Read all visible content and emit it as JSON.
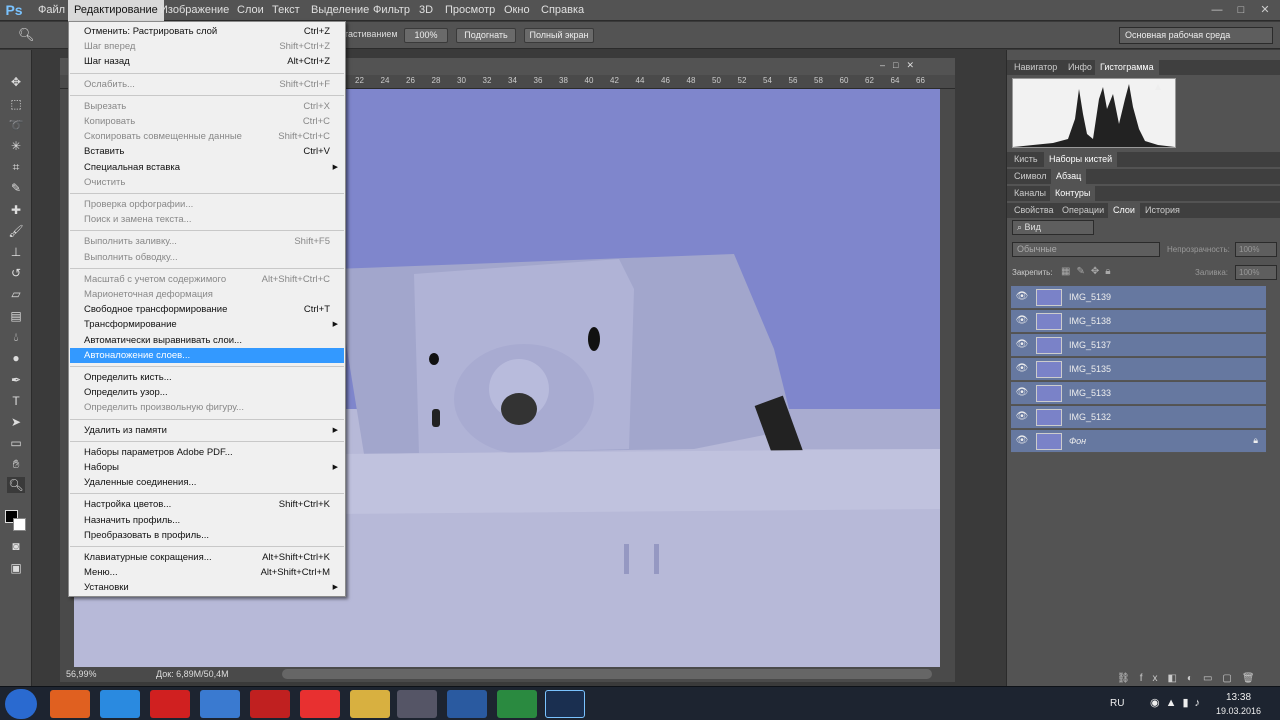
{
  "app": {
    "logo": "Ps"
  },
  "menubar": {
    "items": [
      "Файл",
      "Редактирование",
      "Изображение",
      "Слои",
      "Текст",
      "Выделение",
      "Фильтр",
      "3D",
      "Просмотр",
      "Окно",
      "Справка"
    ]
  },
  "window_controls": {
    "min": "—",
    "max": "□",
    "close": "✕"
  },
  "options_bar": {
    "scrub_label": "тастиванием",
    "btn_100": "100%",
    "btn_fit": "Подогнать",
    "btn_full": "Полный экран",
    "workspace": "Основная рабочая среда"
  },
  "ruler": {
    "ticks": [
      "22",
      "24",
      "26",
      "28",
      "30",
      "32",
      "34",
      "36",
      "38",
      "40",
      "42",
      "44",
      "46",
      "48",
      "50",
      "52",
      "54",
      "56",
      "58",
      "60",
      "62",
      "64",
      "66"
    ]
  },
  "status": {
    "zoom": "56,99%",
    "doc": "Док: 6,89M/50,4M"
  },
  "edit_menu": [
    {
      "label": "Отменить: Растрировать слой",
      "shortcut": "Ctrl+Z",
      "disabled": false
    },
    {
      "label": "Шаг вперед",
      "shortcut": "Shift+Ctrl+Z",
      "disabled": true
    },
    {
      "label": "Шаг назад",
      "shortcut": "Alt+Ctrl+Z",
      "disabled": false
    },
    {
      "sep": true
    },
    {
      "label": "Ослабить...",
      "shortcut": "Shift+Ctrl+F",
      "disabled": true
    },
    {
      "sep": true
    },
    {
      "label": "Вырезать",
      "shortcut": "Ctrl+X",
      "disabled": true
    },
    {
      "label": "Копировать",
      "shortcut": "Ctrl+C",
      "disabled": true
    },
    {
      "label": "Скопировать совмещенные данные",
      "shortcut": "Shift+Ctrl+C",
      "disabled": true
    },
    {
      "label": "Вставить",
      "shortcut": "Ctrl+V",
      "disabled": false
    },
    {
      "label": "Специальная вставка",
      "shortcut": "",
      "submenu": true,
      "disabled": false
    },
    {
      "label": "Очистить",
      "shortcut": "",
      "disabled": true
    },
    {
      "sep": true
    },
    {
      "label": "Проверка орфографии...",
      "shortcut": "",
      "disabled": true
    },
    {
      "label": "Поиск и замена текста...",
      "shortcut": "",
      "disabled": true
    },
    {
      "sep": true
    },
    {
      "label": "Выполнить заливку...",
      "shortcut": "Shift+F5",
      "disabled": true
    },
    {
      "label": "Выполнить обводку...",
      "shortcut": "",
      "disabled": true
    },
    {
      "sep": true
    },
    {
      "label": "Масштаб с учетом содержимого",
      "shortcut": "Alt+Shift+Ctrl+C",
      "disabled": true
    },
    {
      "label": "Марионеточная деформация",
      "shortcut": "",
      "disabled": true
    },
    {
      "label": "Свободное трансформирование",
      "shortcut": "Ctrl+T",
      "disabled": false
    },
    {
      "label": "Трансформирование",
      "shortcut": "",
      "submenu": true,
      "disabled": false
    },
    {
      "label": "Автоматически выравнивать слои...",
      "shortcut": "",
      "disabled": false
    },
    {
      "label": "Автоналожение слоев...",
      "shortcut": "",
      "disabled": false,
      "highlighted": true
    },
    {
      "sep": true
    },
    {
      "label": "Определить кисть...",
      "shortcut": "",
      "disabled": false
    },
    {
      "label": "Определить узор...",
      "shortcut": "",
      "disabled": false
    },
    {
      "label": "Определить произвольную фигуру...",
      "shortcut": "",
      "disabled": true
    },
    {
      "sep": true
    },
    {
      "label": "Удалить из памяти",
      "shortcut": "",
      "submenu": true,
      "disabled": false
    },
    {
      "sep": true
    },
    {
      "label": "Наборы параметров Adobe PDF...",
      "shortcut": "",
      "disabled": false
    },
    {
      "label": "Наборы",
      "shortcut": "",
      "submenu": true,
      "disabled": false
    },
    {
      "label": "Удаленные соединения...",
      "shortcut": "",
      "disabled": false
    },
    {
      "sep": true
    },
    {
      "label": "Настройка цветов...",
      "shortcut": "Shift+Ctrl+K",
      "disabled": false
    },
    {
      "label": "Назначить профиль...",
      "shortcut": "",
      "disabled": false
    },
    {
      "label": "Преобразовать в профиль...",
      "shortcut": "",
      "disabled": false
    },
    {
      "sep": true
    },
    {
      "label": "Клавиатурные сокращения...",
      "shortcut": "Alt+Shift+Ctrl+K",
      "disabled": false
    },
    {
      "label": "Меню...",
      "shortcut": "Alt+Shift+Ctrl+M",
      "disabled": false
    },
    {
      "label": "Установки",
      "shortcut": "",
      "submenu": true,
      "disabled": false
    }
  ],
  "panels": {
    "tabs1": [
      "Навигатор",
      "Инфо",
      "Гистограмма"
    ],
    "tabs2": [
      "Кисть",
      "Наборы кистей"
    ],
    "tabs3": [
      "Символ",
      "Абзац"
    ],
    "tabs4": [
      "Каналы",
      "Контуры"
    ],
    "tabs5": [
      "Свойства",
      "Операции",
      "Слои",
      "История"
    ],
    "layers": {
      "filter": "Вид",
      "blend": "Обычные",
      "opacity_label": "Непрозрачность:",
      "opacity": "100%",
      "lock_label": "Закрепить:",
      "fill_label": "Заливка:",
      "fill": "100%",
      "items": [
        "IMG_5139",
        "IMG_5138",
        "IMG_5137",
        "IMG_5135",
        "IMG_5133",
        "IMG_5132",
        "Фон"
      ]
    }
  },
  "taskbar": {
    "lang": "RU",
    "time": "13:38",
    "date": "19.03.2016"
  },
  "colors": {
    "accent": "#3399ff",
    "canvas_bg": "#7f86cc",
    "layer_row": "#6678a0"
  }
}
